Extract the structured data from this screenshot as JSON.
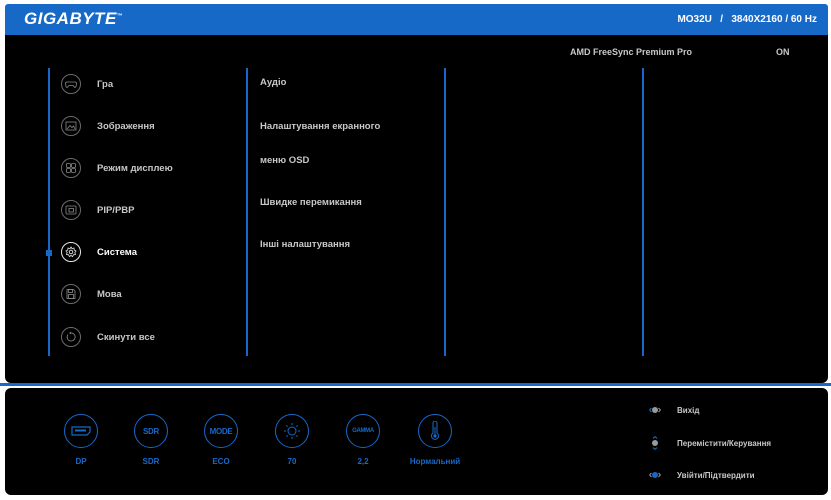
{
  "header": {
    "brand": "GIGABYTE",
    "brand_mark": "™",
    "model": "MO32U",
    "separator": "/",
    "resolution": "3840X2160 / 60 Hz"
  },
  "freesync": {
    "label": "AMD FreeSync Premium Pro",
    "value": "ON"
  },
  "menu": {
    "items": [
      {
        "label": "Гра",
        "icon": "gamepad-icon"
      },
      {
        "label": "Зображення",
        "icon": "picture-icon"
      },
      {
        "label": "Режим дисплею",
        "icon": "display-mode-icon"
      },
      {
        "label": "PIP/PBP",
        "icon": "pip-icon"
      },
      {
        "label": "Система",
        "icon": "gear-icon",
        "active": true
      },
      {
        "label": "Мова",
        "icon": "save-icon"
      },
      {
        "label": "Скинути все",
        "icon": "reset-icon"
      }
    ]
  },
  "submenu": {
    "items": [
      "Аудіо",
      "Налаштування екранного",
      "меню OSD",
      "Швидке перемикання",
      "Інші налаштування"
    ]
  },
  "status": {
    "items": [
      {
        "icon_text": "",
        "value": "DP",
        "icon": "port-icon"
      },
      {
        "icon_text": "SDR",
        "value": "SDR",
        "icon": "sdr-icon"
      },
      {
        "icon_text": "MODE",
        "value": "ECO",
        "icon": "mode-icon"
      },
      {
        "icon_text": "",
        "value": "70",
        "icon": "brightness-icon"
      },
      {
        "icon_text": "GAMMA",
        "value": "2,2",
        "icon": "gamma-icon"
      },
      {
        "icon_text": "",
        "value": "Нормальний",
        "icon": "temperature-icon"
      }
    ]
  },
  "help": {
    "items": [
      {
        "label": "Вихід",
        "icon": "joystick-left-icon"
      },
      {
        "label": "Перемістити/Керування",
        "icon": "joystick-updown-icon"
      },
      {
        "label": "Увійти/Підтвердити",
        "icon": "joystick-press-icon"
      }
    ]
  },
  "colors": {
    "accent": "#1769c8",
    "background": "#000000",
    "text": "#c8c8c8"
  }
}
